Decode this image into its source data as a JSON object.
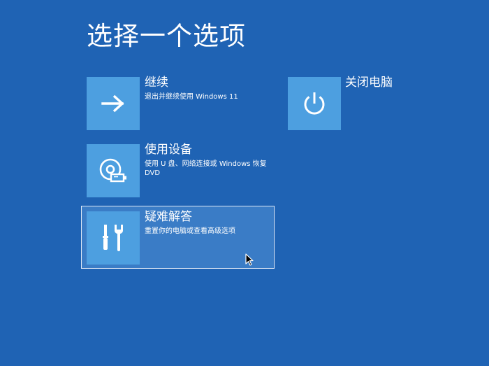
{
  "page": {
    "title": "选择一个选项"
  },
  "options": [
    {
      "id": "continue",
      "label": "继续",
      "description": "退出并继续使用 Windows 11",
      "icon": "arrow-right-icon"
    },
    {
      "id": "shutdown",
      "label": "关闭电脑",
      "description": "",
      "icon": "power-icon"
    },
    {
      "id": "use-device",
      "label": "使用设备",
      "description": "使用 U 盘、网络连接或 Windows 恢复 DVD",
      "icon": "disc-usb-icon"
    },
    {
      "id": "troubleshoot",
      "label": "疑难解答",
      "description": "重置你的电脑或查看高级选项",
      "icon": "tools-icon",
      "selected": true
    }
  ],
  "colors": {
    "background": "#1f63b4",
    "tile": "#4d9fe0",
    "selected_background": "#3a7cc6",
    "selected_border": "#dfe9f6"
  }
}
